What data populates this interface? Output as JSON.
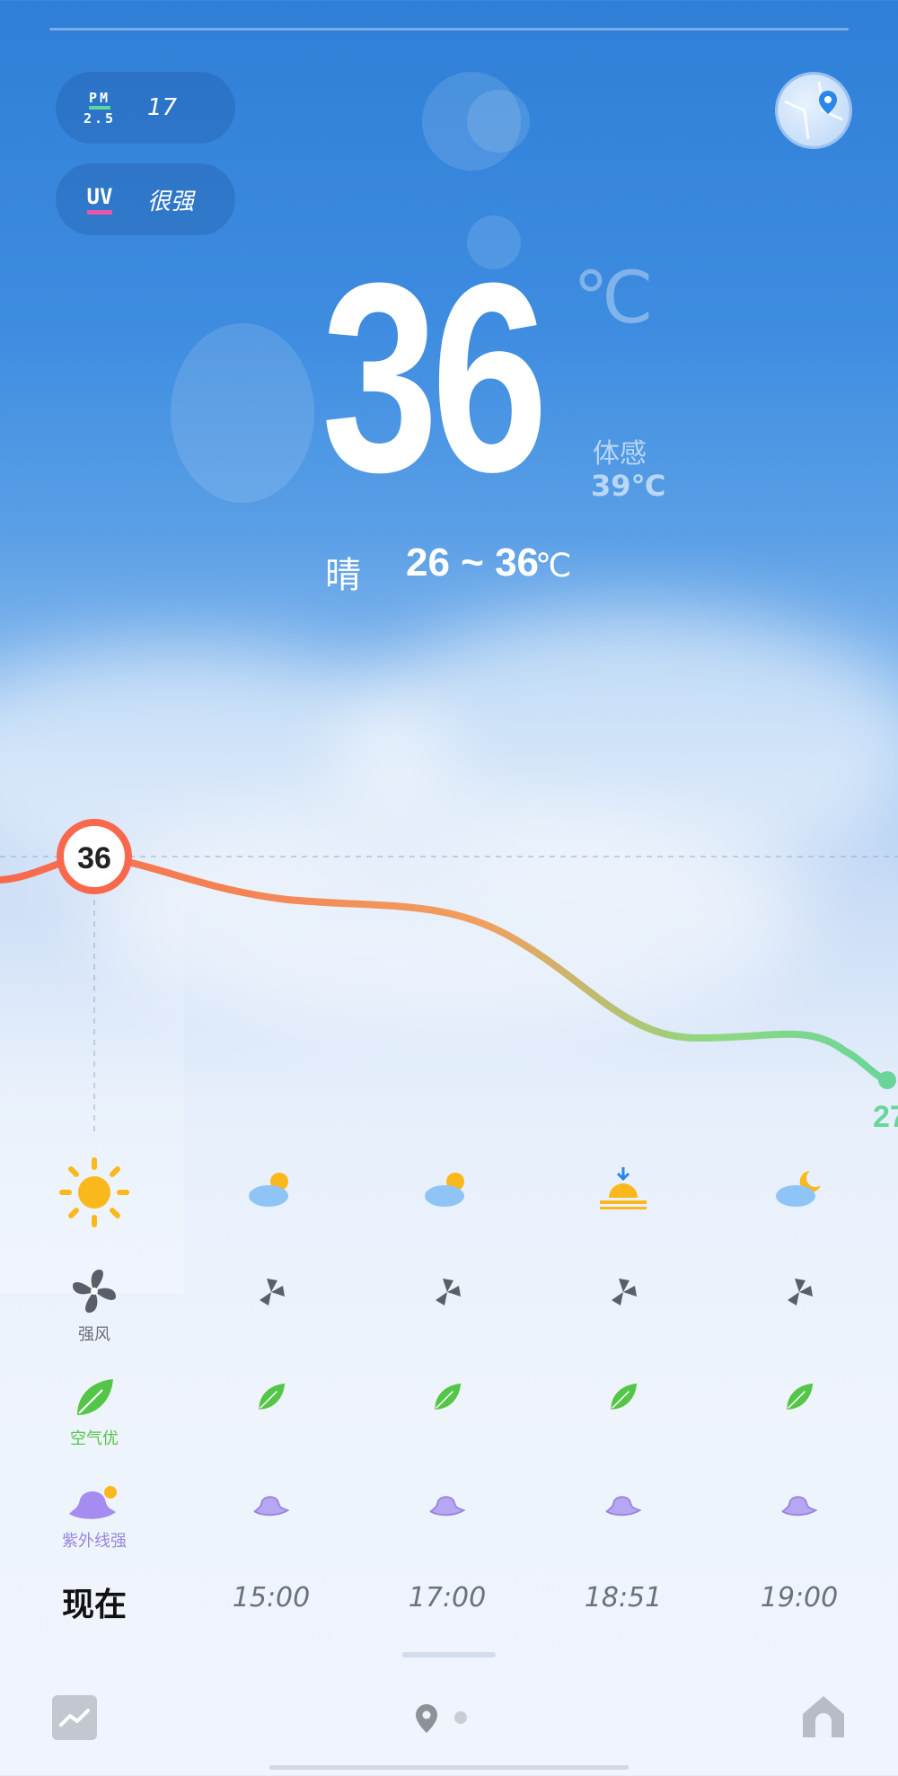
{
  "air": {
    "pm_label_top": "PM",
    "pm_label_bottom": "2.5",
    "pm_value": "17",
    "uv_label": "UV",
    "uv_value": "很强"
  },
  "current": {
    "temperature": "36",
    "unit": "℃",
    "feels_label": "体感",
    "feels_value": "39℃",
    "condition": "晴",
    "range": "26 ~ 36",
    "range_unit": "℃"
  },
  "hourly": {
    "current_marker": "36",
    "end_marker": "27",
    "columns": [
      {
        "time": "现在",
        "weather_icon": "sun-icon",
        "wind_label": "强风",
        "air_label": "空气优",
        "uv_label": "紫外线强"
      },
      {
        "time": "15:00",
        "weather_icon": "partly-cloudy-icon"
      },
      {
        "time": "17:00",
        "weather_icon": "partly-cloudy-icon"
      },
      {
        "time": "18:51",
        "weather_icon": "sunset-icon"
      },
      {
        "time": "19:00",
        "weather_icon": "cloudy-night-icon"
      }
    ]
  },
  "colors": {
    "warm": "#f8684c",
    "mid": "#f0a060",
    "cool": "#6ad59a",
    "leaf": "#55c548",
    "uv_hat": "#a58cf0",
    "fan": "#5a5e66"
  }
}
